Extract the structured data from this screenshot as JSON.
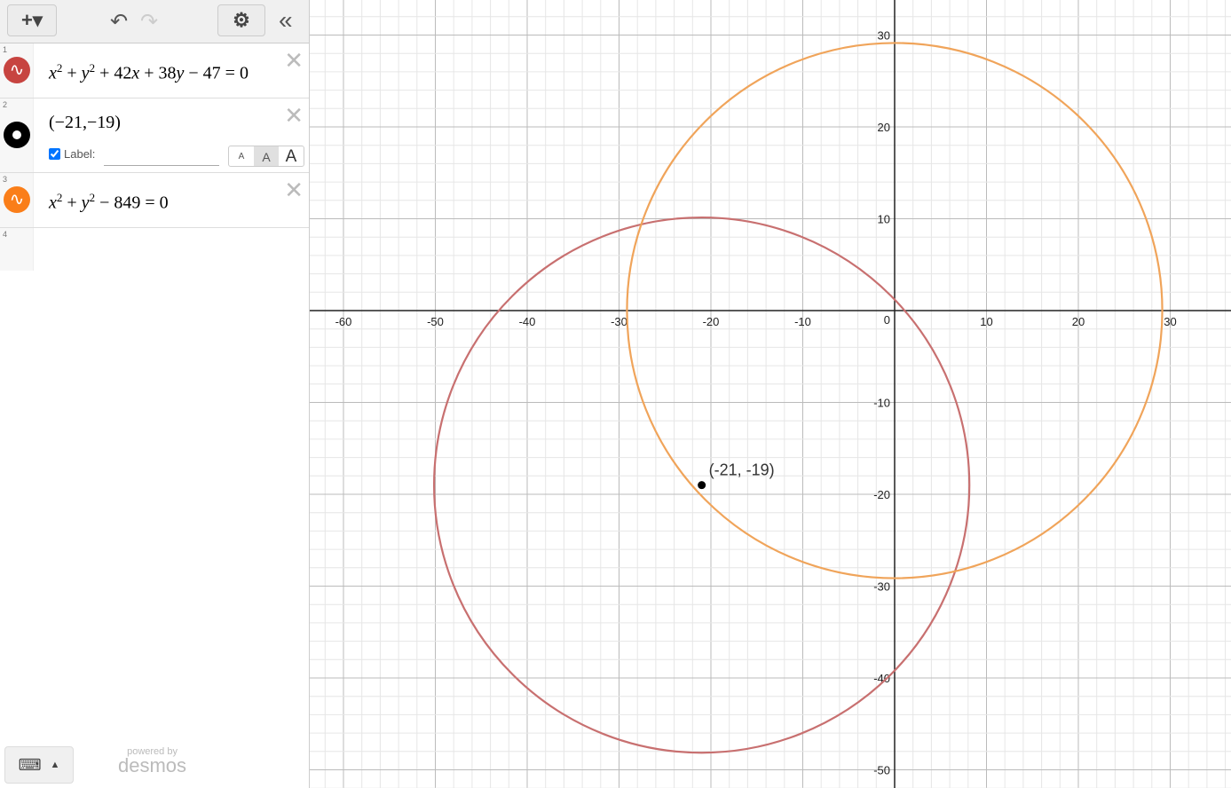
{
  "toolbar": {
    "add": "+▾",
    "undo": "↶",
    "redo": "↷",
    "settings": "⚙",
    "collapse": "«"
  },
  "expressions": [
    {
      "num": "1",
      "color": "#c74440",
      "latex_parts": [
        "x",
        "2",
        "+",
        "y",
        "2",
        "+ 42",
        "x",
        "+ 38",
        "y",
        "− 47 = 0"
      ]
    },
    {
      "num": "2",
      "color": "#000000",
      "text": "(−21,−19)",
      "label_text": "Label:",
      "label_checked": true,
      "label_value": "",
      "sizes": [
        "A",
        "A",
        "A"
      ]
    },
    {
      "num": "3",
      "color": "#fa7e19",
      "latex_parts": [
        "x",
        "2",
        "+",
        "y",
        "2",
        "− 849 = 0"
      ]
    },
    {
      "num": "4"
    }
  ],
  "footer": {
    "powered": "powered by",
    "brand": "desmos"
  },
  "graph": {
    "point_label": "(-21, -19)",
    "point": [
      -21,
      -19
    ],
    "circles": [
      {
        "cx": -21,
        "cy": -19,
        "r2": 849,
        "color": "#c87070"
      },
      {
        "cx": 0,
        "cy": 0,
        "r2": 849,
        "color": "#f0a45a"
      }
    ],
    "x_ticks": [
      "-60",
      "-50",
      "-40",
      "-30",
      "-20",
      "-10",
      "10",
      "20",
      "30"
    ],
    "y_ticks": [
      "30",
      "20",
      "10",
      "-10",
      "-20",
      "-30",
      "-40",
      "-50"
    ],
    "origin_label": "0"
  }
}
